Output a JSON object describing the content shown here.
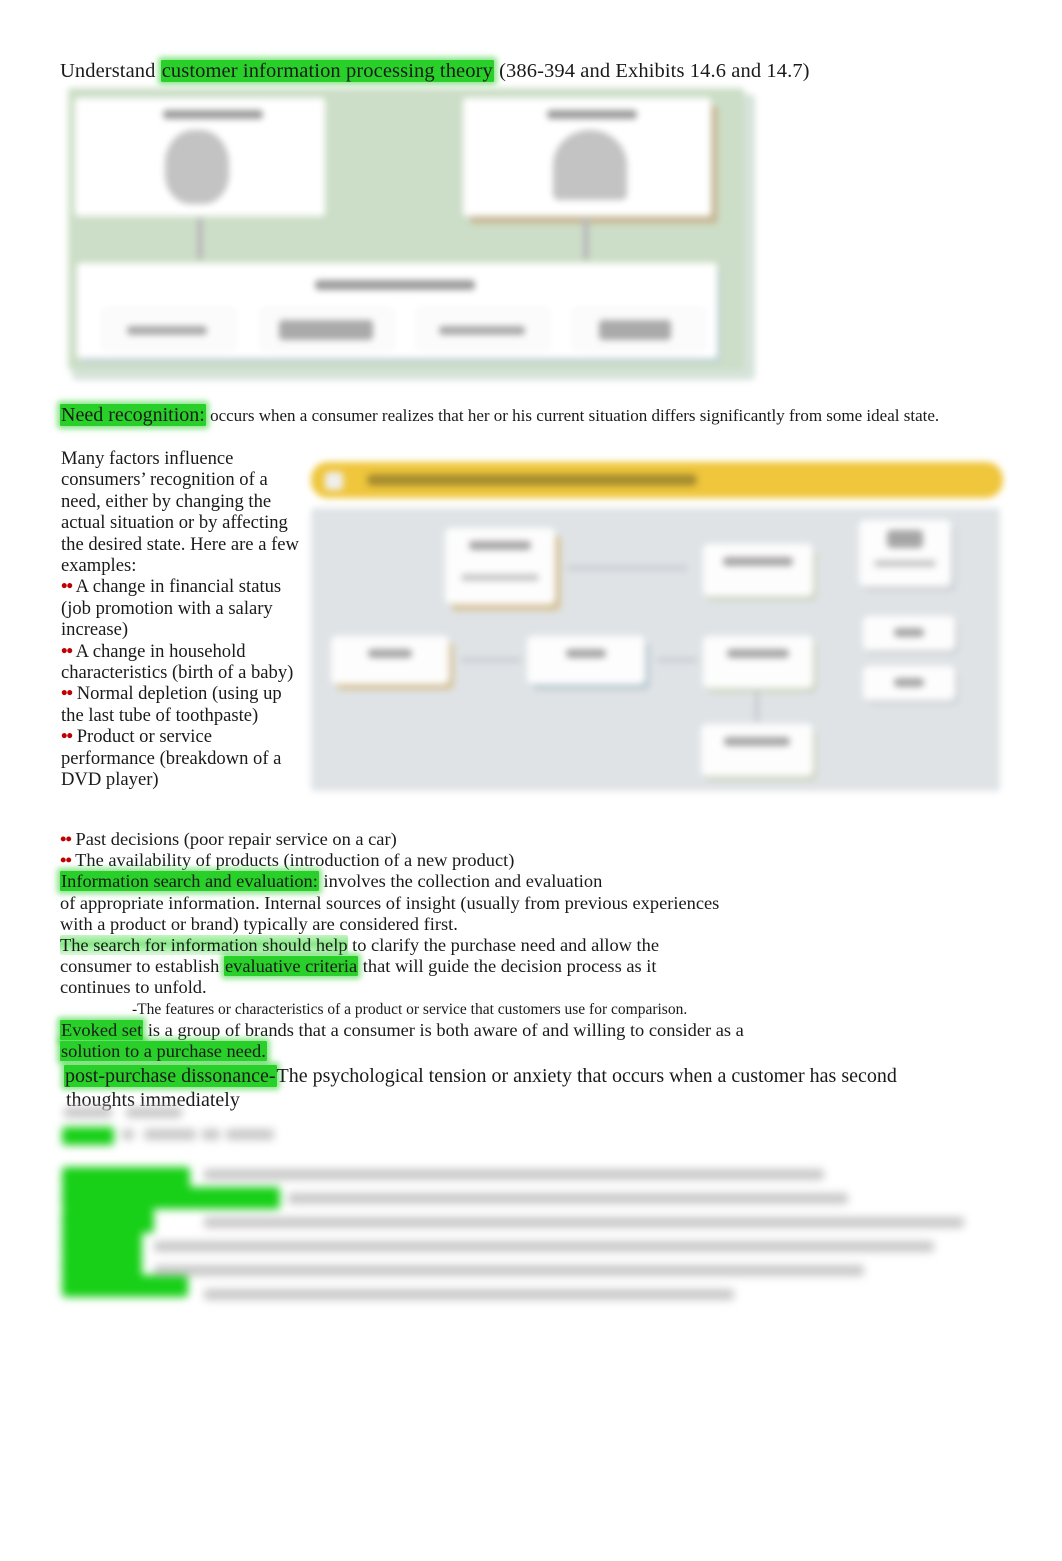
{
  "document": {
    "title_prefix": "Understand ",
    "title_highlight": "customer information processing theory",
    "title_suffix": " (386-394 and Exhibits 14.6 and 14.7)"
  },
  "need_recognition": {
    "term": "Need recognition:",
    "definition": " occurs when a consumer realizes that her or his current situation differs significantly from some ideal state."
  },
  "left_column": {
    "intro": "Many factors influence consumers’ recognition of a need, either by changing the actual situation or by affecting the desired state. Here are a few examples:",
    "bullet_marker": "••",
    "bullets": [
      "A change in financial status (job promotion with a salary increase)",
      "A change in household characteristics (birth of a baby)",
      "Normal depletion (using up the last tube of toothpaste)",
      "Product or service performance (breakdown of a DVD player)"
    ]
  },
  "body": {
    "bullet_marker": "••",
    "bullet_past_decisions": "Past decisions (poor repair service on a car)",
    "bullet_availability": "The availability of products (introduction of a new product)",
    "info_search_term": "Information search and evaluation:",
    "info_search_rest": " involves the collection and evaluation",
    "info_search_line2": "of appropriate information. Internal sources of insight (usually from previous experiences",
    "info_search_line3": "with a product or brand) typically are considered first.",
    "search_line1_hl": "The search for information should help",
    "search_line1_rest": " to clarify the purchase need and allow the",
    "search_line2_pre": "consumer to establish ",
    "search_line2_hl": "evaluative criteria",
    "search_line2_rest": " that will guide the decision process as it",
    "search_line3": "continues to unfold.",
    "evaluative_criteria_def": "-The features or characteristics of a product or service that customers use for comparison.",
    "evoked_set_term": "Evoked set",
    "evoked_set_rest": " is a group of brands that a consumer is both aware of and willing to consider as a",
    "evoked_set_line2": "solution to a purchase need.",
    "dissonance_term": "post-purchase dissonance-",
    "dissonance_rest": "The psychological tension or anxiety that occurs when a customer has second",
    "dissonance_line2": "thoughts immediately"
  },
  "exhibit_1": {
    "name": "exhibit-14-6-diagram",
    "background_color": "#cadec4",
    "card_color": "#ffffff",
    "accent_tan": "#c9b994",
    "accent_blue": "#bfd3d6",
    "state": "blurred"
  },
  "exhibit_2": {
    "name": "exhibit-14-7-diagram",
    "header_color": "#f3c630",
    "body_color": "#dfe3e6",
    "node_color": "#fdfdfd",
    "state": "blurred"
  },
  "redacted": {
    "note": "illegible blurred text",
    "highlight_color": "#17d017"
  }
}
